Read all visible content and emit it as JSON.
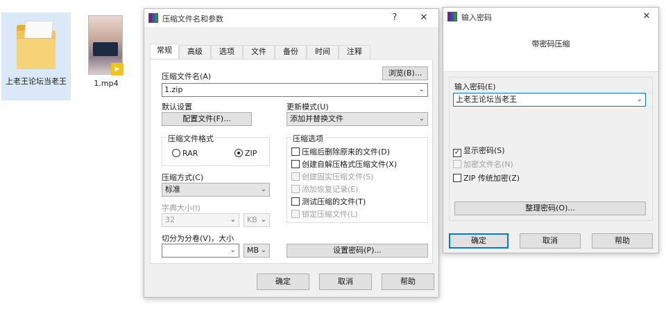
{
  "desktop": {
    "folder_label": "上老王论坛当老王",
    "video_label": "1.mp4",
    "video_badge": "▶"
  },
  "archive_dialog": {
    "title": "压缩文件名和参数",
    "help_btn": "?",
    "close_btn": "✕",
    "tabs": [
      "常规",
      "高级",
      "选项",
      "文件",
      "备份",
      "时间",
      "注释"
    ],
    "filename_label": "压缩文件名(A)",
    "browse_button": "浏览(B)...",
    "filename_value": "1.zip",
    "default_settings_label": "默认设置",
    "profiles_button": "配置文件(F)...",
    "update_mode_label": "更新模式(U)",
    "update_mode_value": "添加并替换文件",
    "format_group": "压缩文件格式",
    "format_rar": "RAR",
    "format_zip": "ZIP",
    "format_selected": "ZIP",
    "options_group": "压缩选项",
    "options": [
      {
        "label": "压缩后删除原来的文件(D)",
        "checked": false,
        "enabled": true
      },
      {
        "label": "创建自解压格式压缩文件(X)",
        "checked": false,
        "enabled": true
      },
      {
        "label": "创建固实压缩文件(S)",
        "checked": false,
        "enabled": false
      },
      {
        "label": "添加恢复记录(E)",
        "checked": false,
        "enabled": false
      },
      {
        "label": "测试压缩的文件(T)",
        "checked": false,
        "enabled": true
      },
      {
        "label": "锁定压缩文件(L)",
        "checked": false,
        "enabled": false
      }
    ],
    "method_label": "压缩方式(C)",
    "method_value": "标准",
    "dict_label": "字典大小(I)",
    "dict_value": "32",
    "dict_unit": "KB",
    "split_label": "切分为分卷(V)，大小",
    "split_value": "",
    "split_unit": "MB",
    "set_password_button": "设置密码(P)...",
    "ok_button": "确定",
    "cancel_button": "取消",
    "help_button": "帮助"
  },
  "password_dialog": {
    "title": "输入密码",
    "close_btn": "✕",
    "heading": "带密码压缩",
    "password_label": "输入密码(E)",
    "password_value": "上老王论坛当老王",
    "show_password": "显示密码(S)",
    "encrypt_names": "加密文件名(N)",
    "zip_legacy": "ZIP 传统加密(Z)",
    "organize_button": "整理密码(O)...",
    "ok_button": "确定",
    "cancel_button": "取消",
    "help_button": "帮助"
  },
  "checkmark": "✓",
  "caret": "⌄",
  "colors": {
    "accent_border": "#0078d7",
    "folder": "#f1c358",
    "selection": "#dbe8f8"
  }
}
